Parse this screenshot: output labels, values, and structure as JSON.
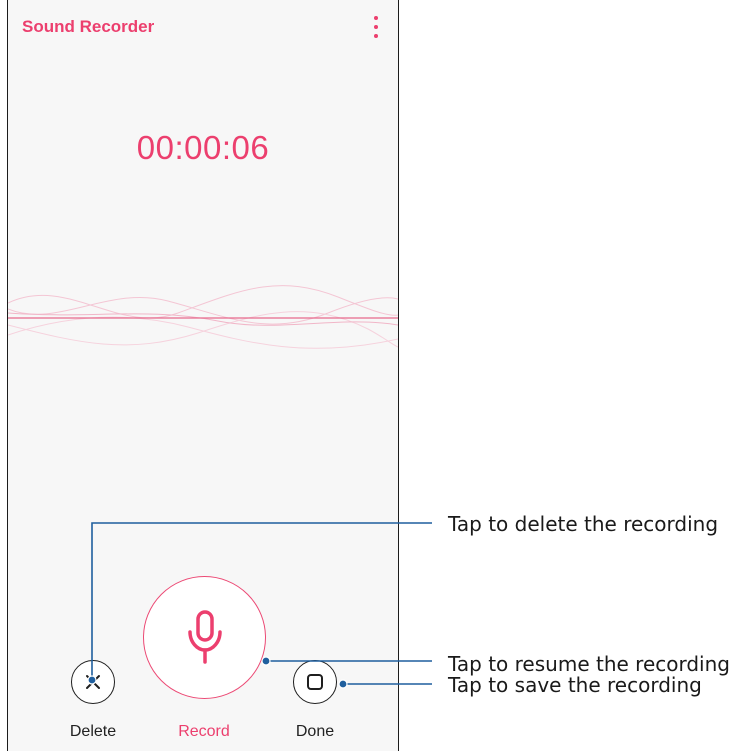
{
  "app": {
    "title": "Sound Recorder",
    "menu_icon": "more-vert-icon",
    "accent_color": "#ec3f6e"
  },
  "recorder": {
    "elapsed_time": "00:00:06"
  },
  "controls": {
    "delete_label": "Delete",
    "delete_icon": "close-icon",
    "record_label": "Record",
    "record_icon": "microphone-icon",
    "done_label": "Done",
    "done_icon": "stop-square-icon"
  },
  "callouts": {
    "delete": "Tap to delete the recording",
    "resume": "Tap to resume the recording",
    "save": "Tap to save the recording",
    "line_color": "#1f5f9e"
  }
}
